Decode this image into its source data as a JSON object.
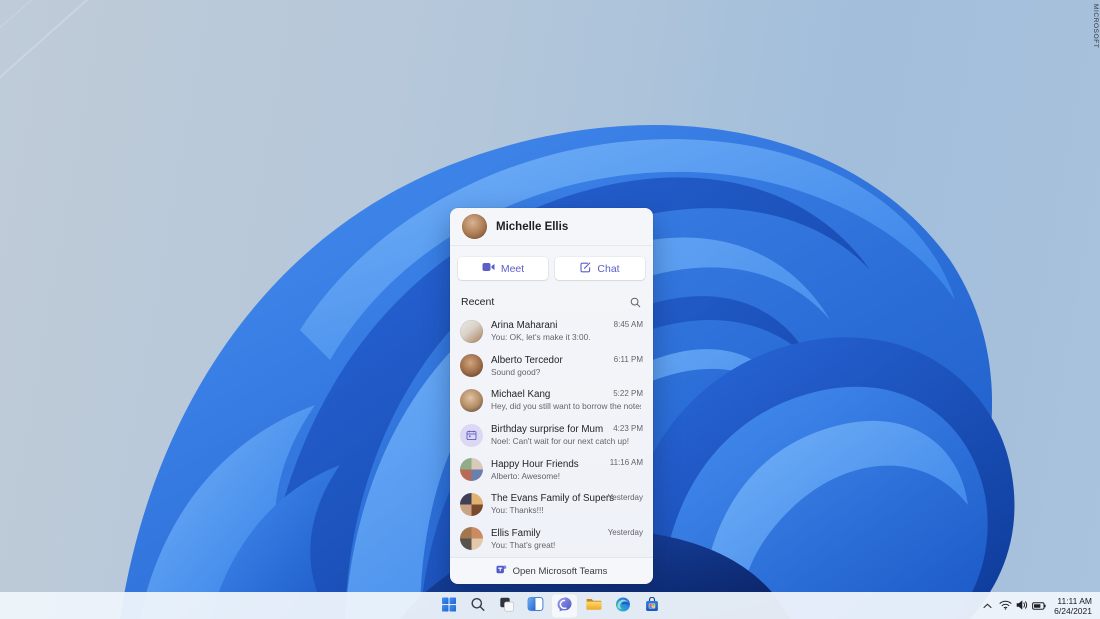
{
  "watermark": "MICROSOFT",
  "teams_flyout": {
    "user_name": "Michelle Ellis",
    "actions": {
      "meet_label": "Meet",
      "meet_icon": "video-camera-icon",
      "chat_label": "Chat",
      "chat_icon": "compose-icon"
    },
    "recent_label": "Recent",
    "search_icon": "search-icon",
    "items": [
      {
        "name": "Arina Maharani",
        "preview": "You: OK, let's make it 3:00.",
        "time": "8:45 AM",
        "avatar": "photo"
      },
      {
        "name": "Alberto Tercedor",
        "preview": "Sound good?",
        "time": "6:11 PM",
        "avatar": "photo"
      },
      {
        "name": "Michael Kang",
        "preview": "Hey, did you still want to borrow the notes?",
        "time": "5:22 PM",
        "avatar": "photo"
      },
      {
        "name": "Birthday surprise for Mum",
        "preview": "Noel: Can't wait for our next catch up!",
        "time": "4:23 PM",
        "avatar": "calendar-icon"
      },
      {
        "name": "Happy Hour Friends",
        "preview": "Alberto: Awesome!",
        "time": "11:16 AM",
        "avatar": "group-photo"
      },
      {
        "name": "The Evans Family of Supers",
        "preview": "You: Thanks!!!",
        "time": "Yesterday",
        "avatar": "group-photo"
      },
      {
        "name": "Ellis Family",
        "preview": "You: That's great!",
        "time": "Yesterday",
        "avatar": "group-photo"
      }
    ],
    "footer": {
      "label": "Open Microsoft Teams",
      "icon": "teams-icon"
    }
  },
  "taskbar": {
    "icons": [
      {
        "name": "start-icon"
      },
      {
        "name": "search-icon"
      },
      {
        "name": "task-view-icon"
      },
      {
        "name": "widgets-icon"
      },
      {
        "name": "chat-icon",
        "active": true
      },
      {
        "name": "file-explorer-icon"
      },
      {
        "name": "edge-icon"
      },
      {
        "name": "store-icon"
      }
    ],
    "tray": {
      "icons": [
        "hidden-icons-chevron",
        "wifi-icon",
        "volume-icon",
        "battery-icon"
      ],
      "time": "11:11 AM",
      "date": "6/24/2021"
    }
  },
  "colors": {
    "teams_accent": "#5b5fc7",
    "wallpaper_bright_blue": "#3f8bf0",
    "wallpaper_dark_blue": "#0d3a98",
    "wallpaper_sky": "#a9c2dd",
    "taskbar_bg": "#eef4fb",
    "flyout_bg": "#f2f4f9"
  }
}
